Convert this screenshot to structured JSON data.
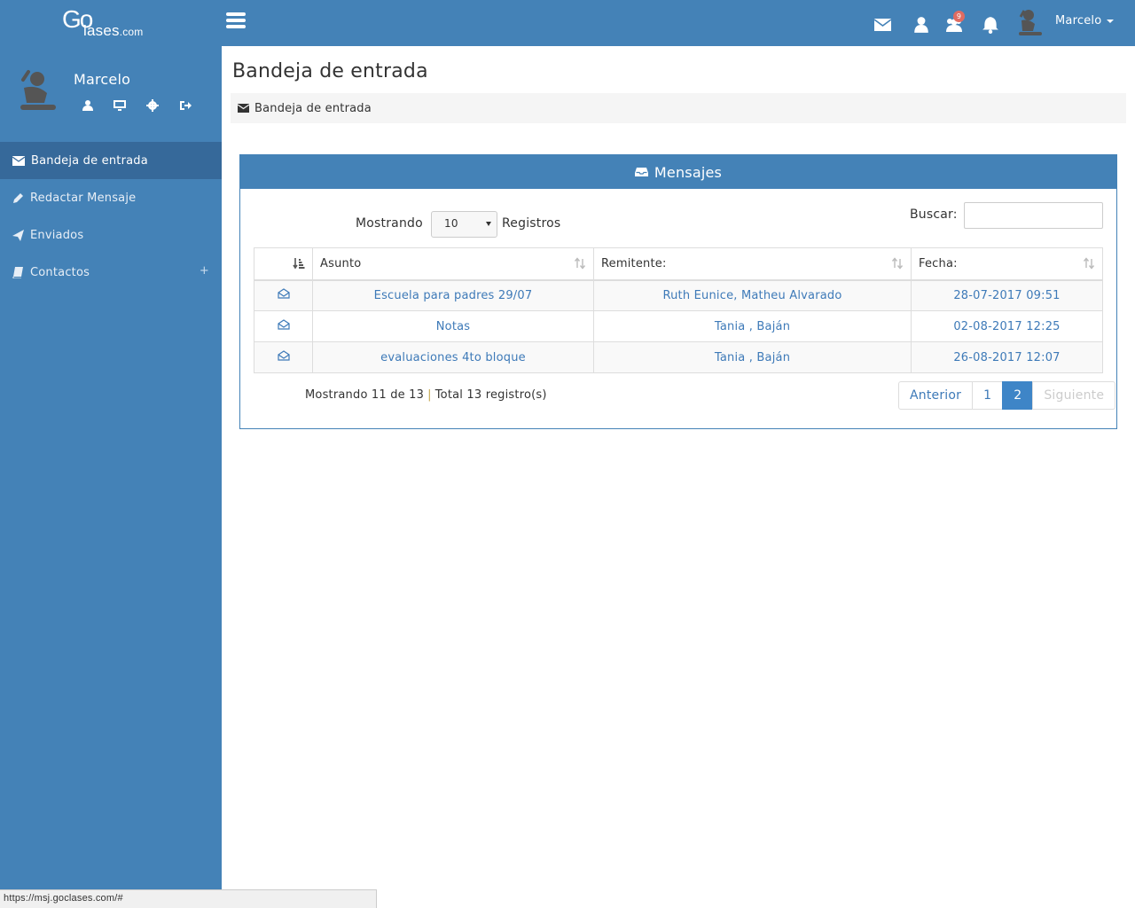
{
  "header": {
    "logo_go": "Go",
    "logo_word": "lases",
    "logo_tld": ".com",
    "user_name": "Marcelo",
    "notification_badge": "9"
  },
  "sidebar": {
    "user_name": "Marcelo",
    "items": [
      {
        "label": "Bandeja de entrada",
        "icon": "envelope-icon",
        "active": true
      },
      {
        "label": "Redactar Mensaje",
        "icon": "pencil-icon"
      },
      {
        "label": "Enviados",
        "icon": "paper-plane-icon"
      },
      {
        "label": "Contactos",
        "icon": "book-icon",
        "expander": "+"
      }
    ]
  },
  "main": {
    "page_title": "Bandeja de entrada",
    "breadcrumb": "Bandeja de entrada",
    "panel_title": "Mensajes",
    "length_label_prefix": "Mostrando",
    "length_value": "10",
    "length_label_suffix": "Registros",
    "search_label": "Buscar:",
    "search_value": "",
    "columns": [
      "",
      "Asunto",
      "Remitente:",
      "Fecha:"
    ],
    "rows": [
      {
        "asunto": "Escuela para padres 29/07",
        "remitente": "Ruth Eunice, Matheu Alvarado",
        "fecha": "28-07-2017 09:51"
      },
      {
        "asunto": "Notas",
        "remitente": "Tania , Baján",
        "fecha": "02-08-2017 12:25"
      },
      {
        "asunto": "evaluaciones 4to bloque",
        "remitente": "Tania , Baján",
        "fecha": "26-08-2017 12:07"
      }
    ],
    "info_showing": "Mostrando 11 de 13",
    "info_sep": "|",
    "info_total": "Total 13 registro(s)",
    "pager": {
      "prev": "Anterior",
      "pages": [
        "1",
        "2"
      ],
      "current": "2",
      "next": "Siguiente"
    }
  },
  "status_url": "https://msj.goclases.com/#",
  "colors": {
    "primary": "#4482b7",
    "active_nav": "#36699a",
    "link": "#3e7ab8",
    "badge": "#e06b61"
  }
}
